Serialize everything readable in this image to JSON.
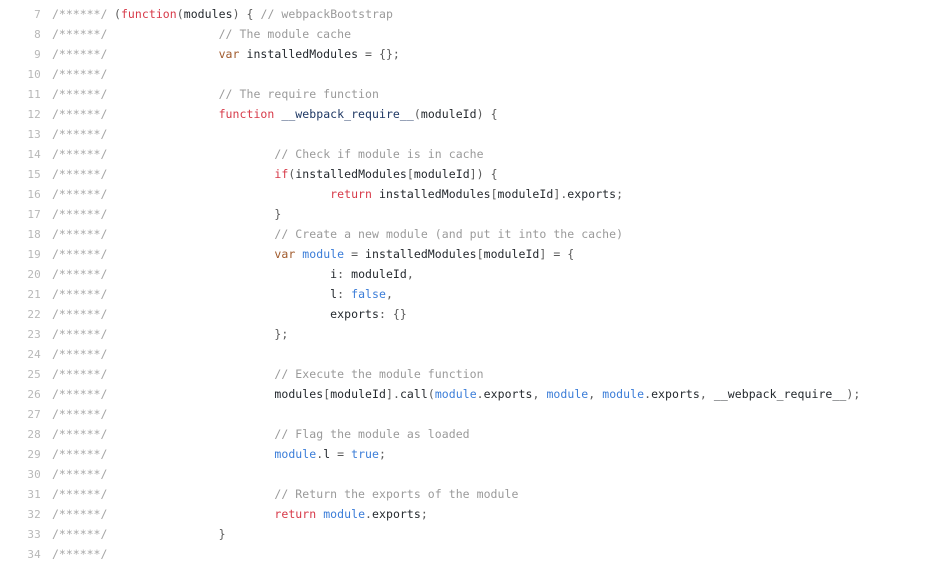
{
  "viewer": {
    "name": "code-viewer",
    "language": "javascript",
    "theme": "light",
    "background_color": "#ffffff",
    "gutter_prefix": "/******/",
    "first_line_number": 7,
    "last_line_number": 34,
    "colors": {
      "keyword": "#d73a49",
      "var_keyword": "#a05a2c",
      "comment": "#9a9a9a",
      "identifier": "#24292e",
      "function_name": "#1f3864",
      "constant": "#3b7dd8",
      "punctuation": "#5a5a5a",
      "line_number": "#b8b8b8",
      "gutter_stars": "#a6a6a6"
    }
  },
  "lines": [
    {
      "number": "7",
      "stars": "/******/",
      "tokens": [
        {
          "t": "punct",
          "s": " ("
        },
        {
          "t": "kw",
          "s": "function"
        },
        {
          "t": "punct",
          "s": "("
        },
        {
          "t": "ident",
          "s": "modules"
        },
        {
          "t": "punct",
          "s": ") { "
        },
        {
          "t": "comment",
          "s": "// webpackBootstrap"
        }
      ]
    },
    {
      "number": "8",
      "stars": "/******/",
      "tokens": [
        {
          "t": "comment",
          "s": "        \t// The module cache"
        }
      ]
    },
    {
      "number": "9",
      "stars": "/******/",
      "tokens": [
        {
          "t": "plain",
          "s": "        \t"
        },
        {
          "t": "var",
          "s": "var"
        },
        {
          "t": "ident",
          "s": " installedModules "
        },
        {
          "t": "punct",
          "s": "= {};"
        }
      ]
    },
    {
      "number": "10",
      "stars": "/******/",
      "tokens": []
    },
    {
      "number": "11",
      "stars": "/******/",
      "tokens": [
        {
          "t": "comment",
          "s": "        \t// The require function"
        }
      ]
    },
    {
      "number": "12",
      "stars": "/******/",
      "tokens": [
        {
          "t": "plain",
          "s": "        \t"
        },
        {
          "t": "kw",
          "s": "function"
        },
        {
          "t": "fn",
          "s": " __webpack_require__"
        },
        {
          "t": "punct",
          "s": "("
        },
        {
          "t": "ident",
          "s": "moduleId"
        },
        {
          "t": "punct",
          "s": ") {"
        }
      ]
    },
    {
      "number": "13",
      "stars": "/******/",
      "tokens": []
    },
    {
      "number": "14",
      "stars": "/******/",
      "tokens": [
        {
          "t": "comment",
          "s": "        \t\t// Check if module is in cache"
        }
      ]
    },
    {
      "number": "15",
      "stars": "/******/",
      "tokens": [
        {
          "t": "plain",
          "s": "        \t\t"
        },
        {
          "t": "kw",
          "s": "if"
        },
        {
          "t": "punct",
          "s": "("
        },
        {
          "t": "ident",
          "s": "installedModules"
        },
        {
          "t": "punct",
          "s": "["
        },
        {
          "t": "ident",
          "s": "moduleId"
        },
        {
          "t": "punct",
          "s": "]) {"
        }
      ]
    },
    {
      "number": "16",
      "stars": "/******/",
      "tokens": [
        {
          "t": "plain",
          "s": "        \t\t\t"
        },
        {
          "t": "kw",
          "s": "return"
        },
        {
          "t": "ident",
          "s": " installedModules"
        },
        {
          "t": "punct",
          "s": "["
        },
        {
          "t": "ident",
          "s": "moduleId"
        },
        {
          "t": "punct",
          "s": "]."
        },
        {
          "t": "prop",
          "s": "exports"
        },
        {
          "t": "punct",
          "s": ";"
        }
      ]
    },
    {
      "number": "17",
      "stars": "/******/",
      "tokens": [
        {
          "t": "punct",
          "s": "        \t\t}"
        }
      ]
    },
    {
      "number": "18",
      "stars": "/******/",
      "tokens": [
        {
          "t": "comment",
          "s": "        \t\t// Create a new module (and put it into the cache)"
        }
      ]
    },
    {
      "number": "19",
      "stars": "/******/",
      "tokens": [
        {
          "t": "plain",
          "s": "        \t\t"
        },
        {
          "t": "var",
          "s": "var"
        },
        {
          "t": "plain",
          "s": " "
        },
        {
          "t": "const",
          "s": "module"
        },
        {
          "t": "punct",
          "s": " = "
        },
        {
          "t": "ident",
          "s": "installedModules"
        },
        {
          "t": "punct",
          "s": "["
        },
        {
          "t": "ident",
          "s": "moduleId"
        },
        {
          "t": "punct",
          "s": "] = {"
        }
      ]
    },
    {
      "number": "20",
      "stars": "/******/",
      "tokens": [
        {
          "t": "ident",
          "s": "        \t\t\ti"
        },
        {
          "t": "punct",
          "s": ": "
        },
        {
          "t": "ident",
          "s": "moduleId"
        },
        {
          "t": "punct",
          "s": ","
        }
      ]
    },
    {
      "number": "21",
      "stars": "/******/",
      "tokens": [
        {
          "t": "ident",
          "s": "        \t\t\tl"
        },
        {
          "t": "punct",
          "s": ": "
        },
        {
          "t": "const",
          "s": "false"
        },
        {
          "t": "punct",
          "s": ","
        }
      ]
    },
    {
      "number": "22",
      "stars": "/******/",
      "tokens": [
        {
          "t": "ident",
          "s": "        \t\t\texports"
        },
        {
          "t": "punct",
          "s": ": {}"
        }
      ]
    },
    {
      "number": "23",
      "stars": "/******/",
      "tokens": [
        {
          "t": "punct",
          "s": "        \t\t};"
        }
      ]
    },
    {
      "number": "24",
      "stars": "/******/",
      "tokens": []
    },
    {
      "number": "25",
      "stars": "/******/",
      "tokens": [
        {
          "t": "comment",
          "s": "        \t\t// Execute the module function"
        }
      ]
    },
    {
      "number": "26",
      "stars": "/******/",
      "tokens": [
        {
          "t": "ident",
          "s": "        \t\tmodules"
        },
        {
          "t": "punct",
          "s": "["
        },
        {
          "t": "ident",
          "s": "moduleId"
        },
        {
          "t": "punct",
          "s": "]."
        },
        {
          "t": "ident",
          "s": "call"
        },
        {
          "t": "punct",
          "s": "("
        },
        {
          "t": "const",
          "s": "module"
        },
        {
          "t": "punct",
          "s": "."
        },
        {
          "t": "prop",
          "s": "exports"
        },
        {
          "t": "punct",
          "s": ", "
        },
        {
          "t": "const",
          "s": "module"
        },
        {
          "t": "punct",
          "s": ", "
        },
        {
          "t": "const",
          "s": "module"
        },
        {
          "t": "punct",
          "s": "."
        },
        {
          "t": "prop",
          "s": "exports"
        },
        {
          "t": "punct",
          "s": ", "
        },
        {
          "t": "ident",
          "s": "__webpack_require__"
        },
        {
          "t": "punct",
          "s": ");"
        }
      ]
    },
    {
      "number": "27",
      "stars": "/******/",
      "tokens": []
    },
    {
      "number": "28",
      "stars": "/******/",
      "tokens": [
        {
          "t": "comment",
          "s": "        \t\t// Flag the module as loaded"
        }
      ]
    },
    {
      "number": "29",
      "stars": "/******/",
      "tokens": [
        {
          "t": "plain",
          "s": "        \t\t"
        },
        {
          "t": "const",
          "s": "module"
        },
        {
          "t": "punct",
          "s": "."
        },
        {
          "t": "ident",
          "s": "l"
        },
        {
          "t": "punct",
          "s": " = "
        },
        {
          "t": "const",
          "s": "true"
        },
        {
          "t": "punct",
          "s": ";"
        }
      ]
    },
    {
      "number": "30",
      "stars": "/******/",
      "tokens": []
    },
    {
      "number": "31",
      "stars": "/******/",
      "tokens": [
        {
          "t": "comment",
          "s": "        \t\t// Return the exports of the module"
        }
      ]
    },
    {
      "number": "32",
      "stars": "/******/",
      "tokens": [
        {
          "t": "plain",
          "s": "        \t\t"
        },
        {
          "t": "kw",
          "s": "return"
        },
        {
          "t": "plain",
          "s": " "
        },
        {
          "t": "const",
          "s": "module"
        },
        {
          "t": "punct",
          "s": "."
        },
        {
          "t": "prop",
          "s": "exports"
        },
        {
          "t": "punct",
          "s": ";"
        }
      ]
    },
    {
      "number": "33",
      "stars": "/******/",
      "tokens": [
        {
          "t": "punct",
          "s": "        \t}"
        }
      ]
    },
    {
      "number": "34",
      "stars": "/******/",
      "tokens": []
    }
  ]
}
